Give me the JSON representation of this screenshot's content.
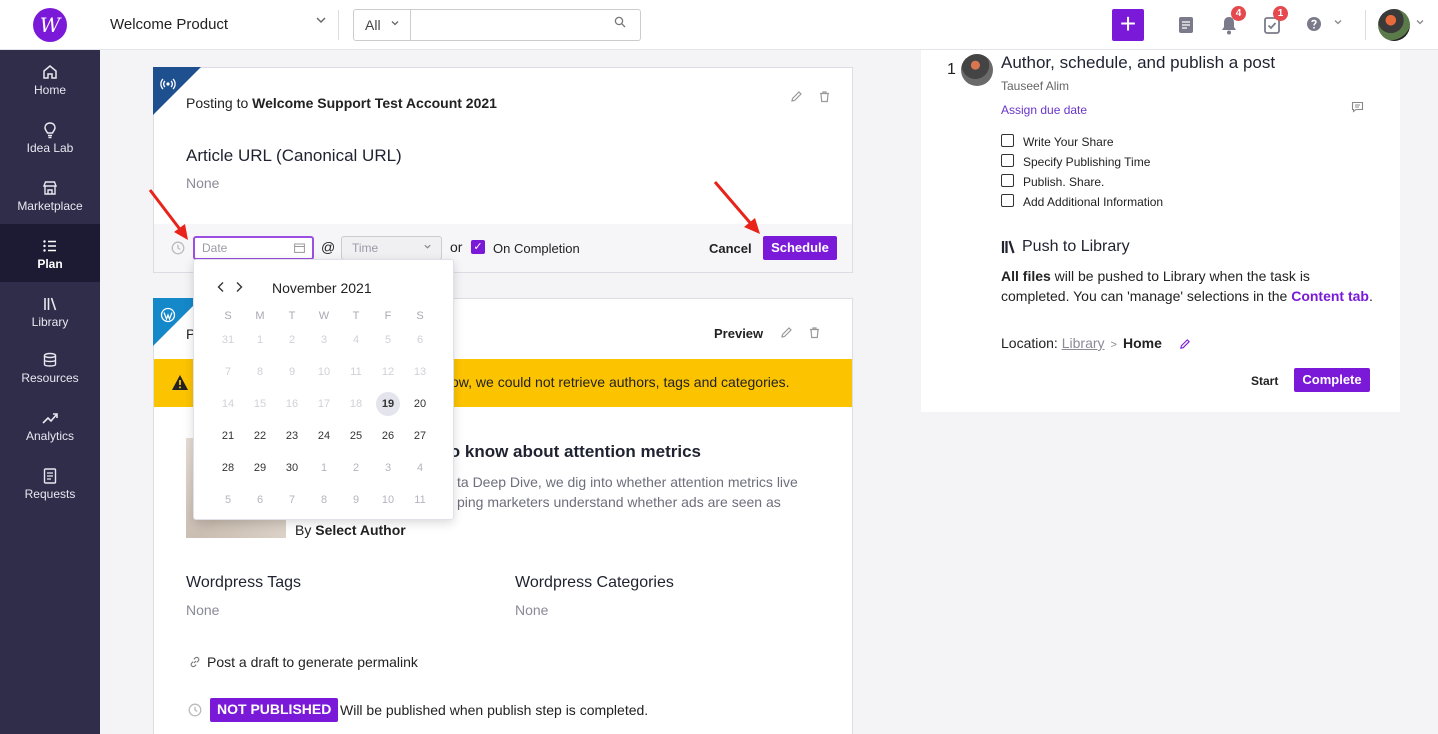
{
  "topbar": {
    "logo_letter": "W",
    "product": "Welcome Product",
    "search_scope": "All",
    "search_placeholder": "",
    "notifications_count": "4",
    "tasks_count": "1",
    "add_symbol": "+"
  },
  "sidebar": {
    "items": [
      {
        "label": "Home",
        "icon": "home-icon"
      },
      {
        "label": "Idea Lab",
        "icon": "lightbulb-icon"
      },
      {
        "label": "Marketplace",
        "icon": "store-icon"
      },
      {
        "label": "Plan",
        "icon": "list-icon"
      },
      {
        "label": "Library",
        "icon": "library-icon"
      },
      {
        "label": "Resources",
        "icon": "database-icon"
      },
      {
        "label": "Analytics",
        "icon": "trend-icon"
      },
      {
        "label": "Requests",
        "icon": "document-icon"
      }
    ],
    "active": "Plan"
  },
  "card1": {
    "posting_prefix": "Posting to ",
    "account": "Welcome Support Test Account 2021",
    "article_heading": "Article URL (Canonical URL)",
    "article_value": "None",
    "schedule": {
      "date_placeholder": "Date",
      "at": "@",
      "time_placeholder": "Time",
      "or": "or",
      "on_completion": "On Completion",
      "on_completion_checked": true,
      "cancel": "Cancel",
      "schedule": "Schedule"
    }
  },
  "card2": {
    "title_start": "P",
    "preview": "Preview",
    "warning": "ow, we could not retrieve authors, tags and categories.",
    "article_title": "d to know about attention metrics",
    "article_desc_1": "ta Deep Dive, we dig into whether attention metrics live",
    "article_desc_2": "ping marketers understand whether ads are seen as",
    "by": "By ",
    "author": "Select Author",
    "tags_heading": "Wordpress Tags",
    "tags_value": "None",
    "categories_heading": "Wordpress Categories",
    "categories_value": "None",
    "permalink": "Post a draft to generate permalink",
    "status_badge": "NOT PUBLISHED",
    "status_text": "Will be published when publish step is completed."
  },
  "calendar": {
    "month": "November 2021",
    "weekdays": [
      "S",
      "M",
      "T",
      "W",
      "T",
      "F",
      "S"
    ],
    "weeks": [
      [
        "31",
        "1",
        "2",
        "3",
        "4",
        "5",
        "6"
      ],
      [
        "7",
        "8",
        "9",
        "10",
        "11",
        "12",
        "13"
      ],
      [
        "14",
        "15",
        "16",
        "17",
        "18",
        "19",
        "20"
      ],
      [
        "21",
        "22",
        "23",
        "24",
        "25",
        "26",
        "27"
      ],
      [
        "28",
        "29",
        "30",
        "1",
        "2",
        "3",
        "4"
      ],
      [
        "5",
        "6",
        "7",
        "8",
        "9",
        "10",
        "11"
      ]
    ],
    "today": "19"
  },
  "task": {
    "number": "1",
    "title": "Author, schedule, and publish a post",
    "user": "Tauseef Alim",
    "assign": "Assign due date",
    "checklist": [
      "Write Your Share",
      "Specify Publishing Time",
      "Publish. Share.",
      "Add Additional Information"
    ],
    "library_heading": "Push to Library",
    "library_desc_bold": "All files",
    "library_desc_1": " will be pushed to Library when the task is completed. You can 'manage' selections in the ",
    "library_desc_link": "Content tab",
    "library_desc_end": ".",
    "location_label": "Location: ",
    "location_library": "Library",
    "location_home": "Home",
    "start": "Start",
    "complete": "Complete"
  },
  "colors": {
    "brand": "#7b19d9",
    "sidebar": "#2f2d4a",
    "warning": "#fcc400",
    "annotation_arrow": "#e8231a"
  }
}
